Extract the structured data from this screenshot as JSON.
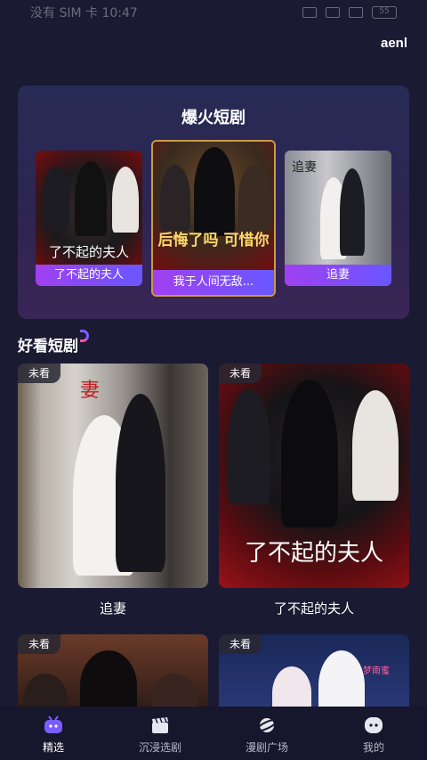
{
  "status_bar": {
    "left_text": "没有 SIM 卡 10:47",
    "battery": "55"
  },
  "top_label": "aenl",
  "hot_section": {
    "title": "爆火短剧",
    "posters": [
      {
        "caption": "了不起的夫人",
        "art_text": "了不起的夫人"
      },
      {
        "caption": "我于人间无敌...",
        "art_text": "后悔了吗 可惜你"
      },
      {
        "caption": "追妻",
        "art_text": "追妻"
      }
    ]
  },
  "good_section": {
    "title": "好看短剧",
    "cards": [
      {
        "badge": "未看",
        "label": "追妻",
        "art_text": "妻"
      },
      {
        "badge": "未看",
        "label": "了不起的夫人",
        "art_text": "了不起的夫人"
      },
      {
        "badge": "未看",
        "label": ""
      },
      {
        "badge": "未看",
        "label": "",
        "art_text": "梦南蜜"
      }
    ]
  },
  "bottom_nav": {
    "items": [
      {
        "label": "精选",
        "icon": "tv-icon",
        "active": true
      },
      {
        "label": "沉浸选剧",
        "icon": "clapperboard-icon",
        "active": false
      },
      {
        "label": "漫剧广场",
        "icon": "planet-icon",
        "active": false
      },
      {
        "label": "我的",
        "icon": "profile-icon",
        "active": false
      }
    ]
  },
  "colors": {
    "background": "#1a1a33",
    "caption_gradient_start": "#a040f0",
    "caption_gradient_end": "#6a57ff",
    "active_icon": "#7b5cff"
  }
}
